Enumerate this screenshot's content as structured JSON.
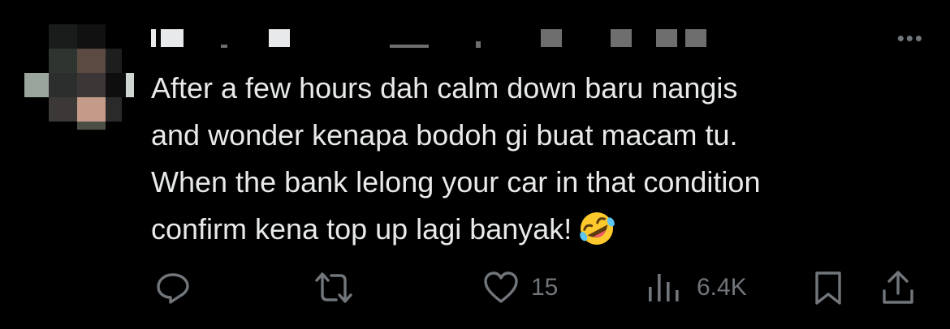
{
  "tweet": {
    "text_lines": [
      "After a few hours dah calm down baru nangis",
      "and wonder kenapa bodoh gi buat macam tu.",
      "When the bank lelong your car in that condition",
      "confirm kena top up lagi banyak!"
    ],
    "emoji": "rolling-on-the-floor-laughing",
    "more_label": "•••"
  },
  "actions": {
    "reply_icon": "reply-icon",
    "retweet_icon": "retweet-icon",
    "like_icon": "heart-icon",
    "like_count": "15",
    "views_icon": "views-icon",
    "views_count": "6.4K",
    "bookmark_icon": "bookmark-icon",
    "share_icon": "share-icon"
  },
  "colors": {
    "background": "#000000",
    "text": "#e7e9ea",
    "muted": "#71767b"
  }
}
